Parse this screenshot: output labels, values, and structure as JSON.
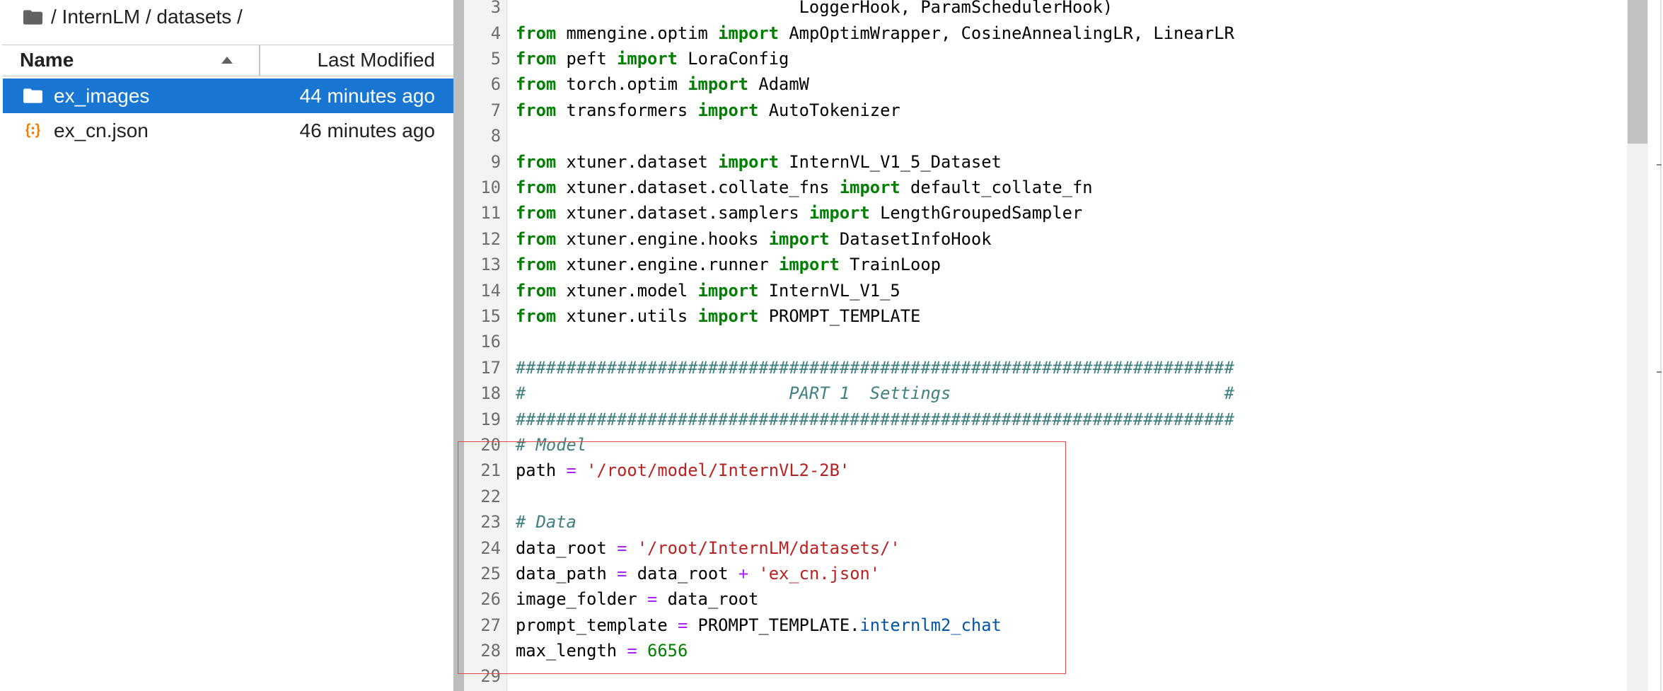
{
  "app": {
    "accent_color": "#1976d2",
    "highlight_color": "#e04848"
  },
  "file_browser": {
    "breadcrumb_icon": "folder-icon",
    "breadcrumb": "/ InternLM / datasets /",
    "columns": [
      {
        "label": "Name",
        "sort": "ascending",
        "sort_icon": "triangle-up-icon"
      },
      {
        "label": "Last Modified"
      }
    ],
    "items": [
      {
        "name": "ex_images",
        "modified": "44 minutes ago",
        "icon": "folder-icon",
        "icon_color": "#ffffff",
        "selected": true
      },
      {
        "name": "ex_cn.json",
        "modified": "46 minutes ago",
        "icon": "json-file-icon",
        "icon_color": "#f57c00",
        "selected": false
      }
    ]
  },
  "editor": {
    "syntax_colors": {
      "keyword": "#008000",
      "string": "#ba2121",
      "operator": "#aa22ff",
      "comment": "#408080",
      "property": "#0055aa",
      "number": "#008000",
      "plain": "#000000"
    },
    "lines": [
      {
        "number": 3,
        "tokens": [
          {
            "type": "plain",
            "text": "                            LoggerHook, ParamSchedulerHook)"
          }
        ]
      },
      {
        "number": 4,
        "tokens": [
          {
            "type": "keyword",
            "text": "from"
          },
          {
            "type": "plain",
            "text": " mmengine.optim "
          },
          {
            "type": "keyword",
            "text": "import"
          },
          {
            "type": "plain",
            "text": " AmpOptimWrapper, CosineAnnealingLR, LinearLR"
          }
        ]
      },
      {
        "number": 5,
        "tokens": [
          {
            "type": "keyword",
            "text": "from"
          },
          {
            "type": "plain",
            "text": " peft "
          },
          {
            "type": "keyword",
            "text": "import"
          },
          {
            "type": "plain",
            "text": " LoraConfig"
          }
        ]
      },
      {
        "number": 6,
        "tokens": [
          {
            "type": "keyword",
            "text": "from"
          },
          {
            "type": "plain",
            "text": " torch.optim "
          },
          {
            "type": "keyword",
            "text": "import"
          },
          {
            "type": "plain",
            "text": " AdamW"
          }
        ]
      },
      {
        "number": 7,
        "tokens": [
          {
            "type": "keyword",
            "text": "from"
          },
          {
            "type": "plain",
            "text": " transformers "
          },
          {
            "type": "keyword",
            "text": "import"
          },
          {
            "type": "plain",
            "text": " AutoTokenizer"
          }
        ]
      },
      {
        "number": 8,
        "tokens": []
      },
      {
        "number": 9,
        "tokens": [
          {
            "type": "keyword",
            "text": "from"
          },
          {
            "type": "plain",
            "text": " xtuner.dataset "
          },
          {
            "type": "keyword",
            "text": "import"
          },
          {
            "type": "plain",
            "text": " InternVL_V1_5_Dataset"
          }
        ]
      },
      {
        "number": 10,
        "tokens": [
          {
            "type": "keyword",
            "text": "from"
          },
          {
            "type": "plain",
            "text": " xtuner.dataset.collate_fns "
          },
          {
            "type": "keyword",
            "text": "import"
          },
          {
            "type": "plain",
            "text": " default_collate_fn"
          }
        ]
      },
      {
        "number": 11,
        "tokens": [
          {
            "type": "keyword",
            "text": "from"
          },
          {
            "type": "plain",
            "text": " xtuner.dataset.samplers "
          },
          {
            "type": "keyword",
            "text": "import"
          },
          {
            "type": "plain",
            "text": " LengthGroupedSampler"
          }
        ]
      },
      {
        "number": 12,
        "tokens": [
          {
            "type": "keyword",
            "text": "from"
          },
          {
            "type": "plain",
            "text": " xtuner.engine.hooks "
          },
          {
            "type": "keyword",
            "text": "import"
          },
          {
            "type": "plain",
            "text": " DatasetInfoHook"
          }
        ]
      },
      {
        "number": 13,
        "tokens": [
          {
            "type": "keyword",
            "text": "from"
          },
          {
            "type": "plain",
            "text": " xtuner.engine.runner "
          },
          {
            "type": "keyword",
            "text": "import"
          },
          {
            "type": "plain",
            "text": " TrainLoop"
          }
        ]
      },
      {
        "number": 14,
        "tokens": [
          {
            "type": "keyword",
            "text": "from"
          },
          {
            "type": "plain",
            "text": " xtuner.model "
          },
          {
            "type": "keyword",
            "text": "import"
          },
          {
            "type": "plain",
            "text": " InternVL_V1_5"
          }
        ]
      },
      {
        "number": 15,
        "tokens": [
          {
            "type": "keyword",
            "text": "from"
          },
          {
            "type": "plain",
            "text": " xtuner.utils "
          },
          {
            "type": "keyword",
            "text": "import"
          },
          {
            "type": "plain",
            "text": " PROMPT_TEMPLATE"
          }
        ]
      },
      {
        "number": 16,
        "tokens": []
      },
      {
        "number": 17,
        "tokens": [
          {
            "type": "comment",
            "text": "#######################################################################"
          }
        ]
      },
      {
        "number": 18,
        "tokens": [
          {
            "type": "comment",
            "text": "#                          PART 1  Settings                           #"
          }
        ]
      },
      {
        "number": 19,
        "tokens": [
          {
            "type": "comment",
            "text": "#######################################################################"
          }
        ]
      },
      {
        "number": 20,
        "tokens": [
          {
            "type": "comment",
            "text": "# Model"
          }
        ]
      },
      {
        "number": 21,
        "tokens": [
          {
            "type": "plain",
            "text": "path "
          },
          {
            "type": "operator",
            "text": "="
          },
          {
            "type": "plain",
            "text": " "
          },
          {
            "type": "string",
            "text": "'/root/model/InternVL2-2B'"
          }
        ]
      },
      {
        "number": 22,
        "tokens": []
      },
      {
        "number": 23,
        "tokens": [
          {
            "type": "comment",
            "text": "# Data"
          }
        ]
      },
      {
        "number": 24,
        "tokens": [
          {
            "type": "plain",
            "text": "data_root "
          },
          {
            "type": "operator",
            "text": "="
          },
          {
            "type": "plain",
            "text": " "
          },
          {
            "type": "string",
            "text": "'/root/InternLM/datasets/'"
          }
        ]
      },
      {
        "number": 25,
        "tokens": [
          {
            "type": "plain",
            "text": "data_path "
          },
          {
            "type": "operator",
            "text": "="
          },
          {
            "type": "plain",
            "text": " data_root "
          },
          {
            "type": "operator",
            "text": "+"
          },
          {
            "type": "plain",
            "text": " "
          },
          {
            "type": "string",
            "text": "'ex_cn.json'"
          }
        ]
      },
      {
        "number": 26,
        "tokens": [
          {
            "type": "plain",
            "text": "image_folder "
          },
          {
            "type": "operator",
            "text": "="
          },
          {
            "type": "plain",
            "text": " data_root"
          }
        ]
      },
      {
        "number": 27,
        "tokens": [
          {
            "type": "plain",
            "text": "prompt_template "
          },
          {
            "type": "operator",
            "text": "="
          },
          {
            "type": "plain",
            "text": " PROMPT_TEMPLATE."
          },
          {
            "type": "property",
            "text": "internlm2_chat"
          }
        ]
      },
      {
        "number": 28,
        "tokens": [
          {
            "type": "plain",
            "text": "max_length "
          },
          {
            "type": "operator",
            "text": "="
          },
          {
            "type": "plain",
            "text": " "
          },
          {
            "type": "number",
            "text": "6656"
          }
        ]
      },
      {
        "number": 29,
        "tokens": []
      }
    ]
  }
}
